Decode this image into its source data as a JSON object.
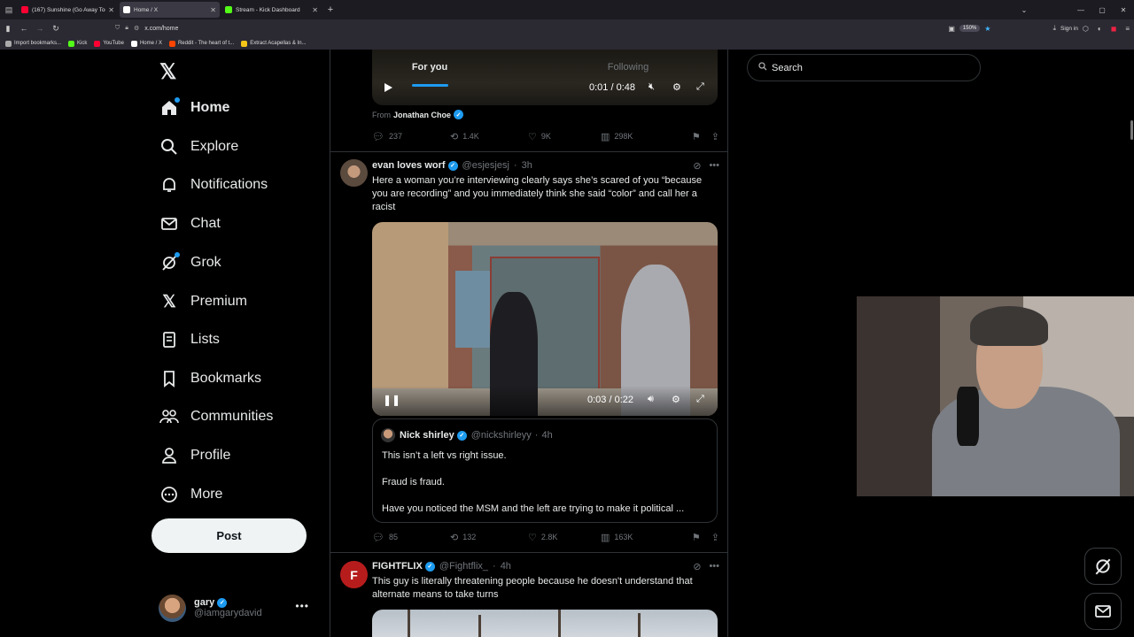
{
  "browser": {
    "tabs": [
      {
        "label": "(167) Sunshine (Go Away Today)",
        "color": "#ff0033",
        "active": false
      },
      {
        "label": "Home / X",
        "color": "#ffffff",
        "active": true
      },
      {
        "label": "Stream - Kick Dashboard",
        "color": "#53fc18",
        "active": false
      }
    ],
    "url": "x.com/home",
    "zoom": "150%",
    "signin": "Sign in",
    "bookmarks": [
      {
        "label": "Import bookmarks...",
        "color": "#aaaaaa"
      },
      {
        "label": "Kick",
        "color": "#53fc18"
      },
      {
        "label": "YouTube",
        "color": "#ff0033"
      },
      {
        "label": "Home / X",
        "color": "#ffffff"
      },
      {
        "label": "Reddit - The heart of t...",
        "color": "#ff4500"
      },
      {
        "label": "Extract Acapellas & In...",
        "color": "#f5c518"
      }
    ]
  },
  "sidebar": {
    "items": [
      {
        "label": "Home",
        "icon": "home-icon",
        "active": true
      },
      {
        "label": "Explore",
        "icon": "search-icon"
      },
      {
        "label": "Notifications",
        "icon": "bell-icon"
      },
      {
        "label": "Chat",
        "icon": "mail-icon"
      },
      {
        "label": "Grok",
        "icon": "grok-icon"
      },
      {
        "label": "Premium",
        "icon": "x-icon"
      },
      {
        "label": "Lists",
        "icon": "list-icon"
      },
      {
        "label": "Bookmarks",
        "icon": "bookmark-icon"
      },
      {
        "label": "Communities",
        "icon": "people-icon"
      },
      {
        "label": "Profile",
        "icon": "person-icon"
      },
      {
        "label": "More",
        "icon": "more-icon"
      }
    ],
    "post_label": "Post",
    "user": {
      "name": "gary",
      "handle": "@iamgarydavid"
    }
  },
  "feed": {
    "tabs": {
      "for_you": "For you",
      "following": "Following"
    },
    "top_video": {
      "time": "0:01 / 0:48",
      "from_prefix": "From",
      "from_name": "Jonathan Choe"
    },
    "top_actions": {
      "replies": "237",
      "reposts": "1.4K",
      "likes": "9K",
      "views": "298K"
    },
    "tweet1": {
      "name": "evan loves worf",
      "handle": "@esjesjesj",
      "time": "3h",
      "text": "Here a woman you’re interviewing clearly says she’s scared of you “because you are recording” and you immediately think she said “color” and call her a racist",
      "video_time": "0:03 / 0:22",
      "quote": {
        "name": "Nick shirley",
        "handle": "@nickshirleyy",
        "time": "4h",
        "line1": "This isn’t a left vs right issue.",
        "line2": "Fraud is fraud.",
        "line3": "Have you noticed the MSM and the left are trying to make it political ..."
      },
      "actions": {
        "replies": "85",
        "reposts": "132",
        "likes": "2.8K",
        "views": "163K"
      }
    },
    "tweet2": {
      "name": "FIGHTFLIX",
      "handle": "@Fightflix_",
      "time": "4h",
      "text": "This guy is literally threatening people because he doesn't understand that alternate means to take turns"
    }
  },
  "right": {
    "search_placeholder": "Search"
  },
  "colors": {
    "accent": "#1d9bf0",
    "background": "#000000",
    "border": "#2f3336",
    "muted": "#71767b"
  }
}
